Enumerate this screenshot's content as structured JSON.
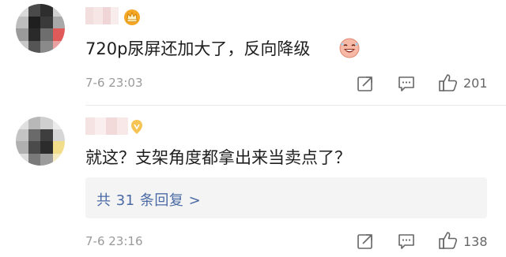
{
  "comments": [
    {
      "text": "720p尿屏还加大了，反向降级",
      "time": "7-6 23:03",
      "likes": "201",
      "avatar_icon": "blurred-avatar",
      "badge_icon": "crown-badge-icon",
      "emoji_icon": "laughing-face-emoji"
    },
    {
      "text": "就这？支架角度都拿出来当卖点了？",
      "time": "7-6 23:16",
      "likes": "138",
      "replies_label": "共 31 条回复 >",
      "avatar_icon": "blurred-avatar",
      "badge_icon": "fan-badge-icon"
    }
  ],
  "icons": {
    "share": "share-icon",
    "comment": "comment-icon",
    "like": "thumbs-up-icon"
  },
  "colors": {
    "time": "#9a9a9a",
    "link": "#4a6aa5",
    "replies_bg": "#f4f4f4",
    "badge_orange": "#f5a623"
  }
}
